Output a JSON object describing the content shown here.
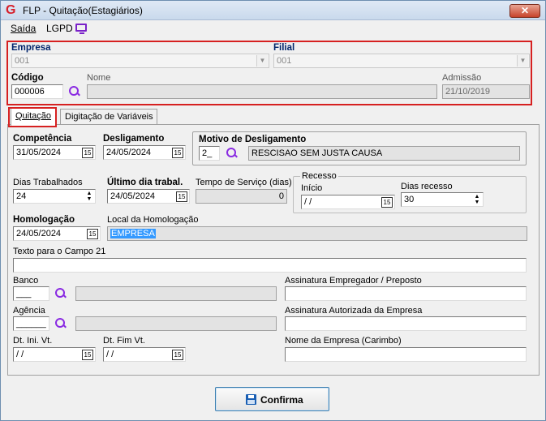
{
  "window": {
    "title": "FLP - Quitação(Estagiários)",
    "close_label": "✕"
  },
  "menu": {
    "saida": "Saída",
    "lgpd": "LGPD"
  },
  "header": {
    "empresa_label": "Empresa",
    "empresa_value": "001",
    "filial_label": "Filial",
    "filial_value": "001",
    "codigo_label": "Código",
    "codigo_value": "000006",
    "nome_label": "Nome",
    "nome_value": "",
    "admissao_label": "Admissão",
    "admissao_value": "21/10/2019"
  },
  "tabs": [
    {
      "label": "Quitação"
    },
    {
      "label": "Digitação de Variáveis"
    }
  ],
  "form": {
    "competencia_label": "Competência",
    "competencia_value": "31/05/2024",
    "desligamento_label": "Desligamento",
    "desligamento_value": "24/05/2024",
    "motivo_label": "Motivo de Desligamento",
    "motivo_code": "2_",
    "motivo_desc": "RESCISAO SEM JUSTA CAUSA",
    "dias_trab_label": "Dias Trabalhados",
    "dias_trab_value": "24",
    "ultimo_dia_label": "Último dia trabal.",
    "ultimo_dia_value": "24/05/2024",
    "tempo_servico_label": "Tempo de Serviço (dias)",
    "tempo_servico_value": "0",
    "recesso_title": "Recesso",
    "recesso_inicio_label": "Início",
    "recesso_inicio_value": " / /",
    "dias_recesso_label": "Dias recesso",
    "dias_recesso_value": "30",
    "homologacao_label": "Homologação",
    "homologacao_value": "24/05/2024",
    "local_homol_label": "Local da Homologação",
    "local_homol_value": "EMPRESA",
    "texto_campo21_label": "Texto para o Campo 21",
    "texto_campo21_value": "",
    "banco_label": "Banco",
    "banco_value": "___",
    "agencia_label": "Agência",
    "agencia_value": "______",
    "dt_ini_vt_label": "Dt. Ini. Vt.",
    "dt_ini_vt_value": " / /",
    "dt_fim_vt_label": "Dt. Fim Vt.",
    "dt_fim_vt_value": " / /",
    "assin_empregador_label": "Assinatura Empregador / Preposto",
    "assin_autorizada_label": "Assinatura Autorizada da Empresa",
    "nome_empresa_label": "Nome da Empresa (Carimbo)"
  },
  "calendar_glyph": "15",
  "footer": {
    "confirm_label": "Confirma"
  },
  "colors": {
    "highlight": "#d62020",
    "search_icon": "#8a2be2",
    "selection": "#3399ff"
  }
}
